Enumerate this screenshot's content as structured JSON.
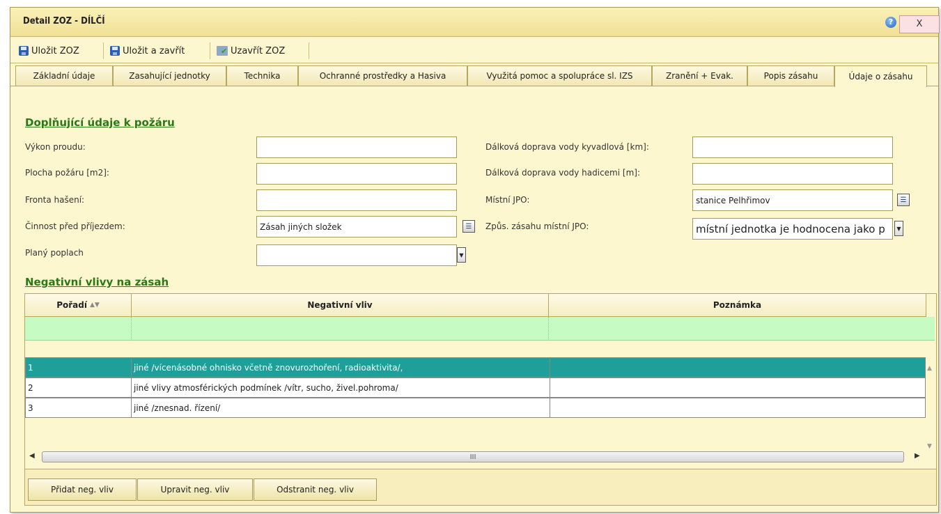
{
  "window": {
    "title": "Detail ZOZ - DÍLČÍ",
    "close_label": "X",
    "help_icon": "help-icon"
  },
  "toolbar": {
    "save": "Uložit ZOZ",
    "save_close": "Uložit a zavřít",
    "close_zoz": "Uzavřít ZOZ"
  },
  "tabs": [
    "Základní údaje",
    "Zasahující jednotky",
    "Technika",
    "Ochranné prostředky a Hasiva",
    "Využitá pomoc a spolupráce sl. IZS",
    "Zranění + Evak.",
    "Popis zásahu",
    "Údaje o zásahu"
  ],
  "section1": {
    "title": "Doplňující údaje k požáru",
    "vykon_label": "Výkon proudu:",
    "plocha_label": "Plocha požáru [m2]:",
    "fronta_label": "Fronta hašení:",
    "cinnost_label": "Činnost před příjezdem:",
    "cinnost_value": "Zásah jiných složek",
    "plany_label": "Planý poplach",
    "dalkova_kyv_label": "Dálková doprava vody kyvadlová [km]:",
    "dalkova_had_label": "Dálková doprava vody hadicemi [m]:",
    "mistni_label": "Místní JPO:",
    "mistni_value": "stanice Pelhřimov",
    "zpus_label": "Způs. zásahu místní JPO:",
    "zpus_value": "místní jednotka je hodnocena jako p"
  },
  "section2": {
    "title": "Negativní vlivy na zásah"
  },
  "grid": {
    "columns": [
      "Pořadí",
      "Negativní vliv",
      "Poznámka"
    ],
    "rows": [
      {
        "poradi": "1",
        "vliv": "jiné /vícenásobné ohnisko včetně znovurozhoření, radioaktivita/,",
        "poznamka": ""
      },
      {
        "poradi": "2",
        "vliv": "jiné vlivy atmosférických podmínek /vítr, sucho, živel.pohroma/",
        "poznamka": ""
      },
      {
        "poradi": "3",
        "vliv": "jiné /znesnad. řízení/",
        "poznamka": ""
      }
    ],
    "scroll_thumb_label": "III"
  },
  "buttons": {
    "add": "Přidat neg. vliv",
    "edit": "Upravit neg. vliv",
    "remove": "Odstranit neg. vliv"
  }
}
